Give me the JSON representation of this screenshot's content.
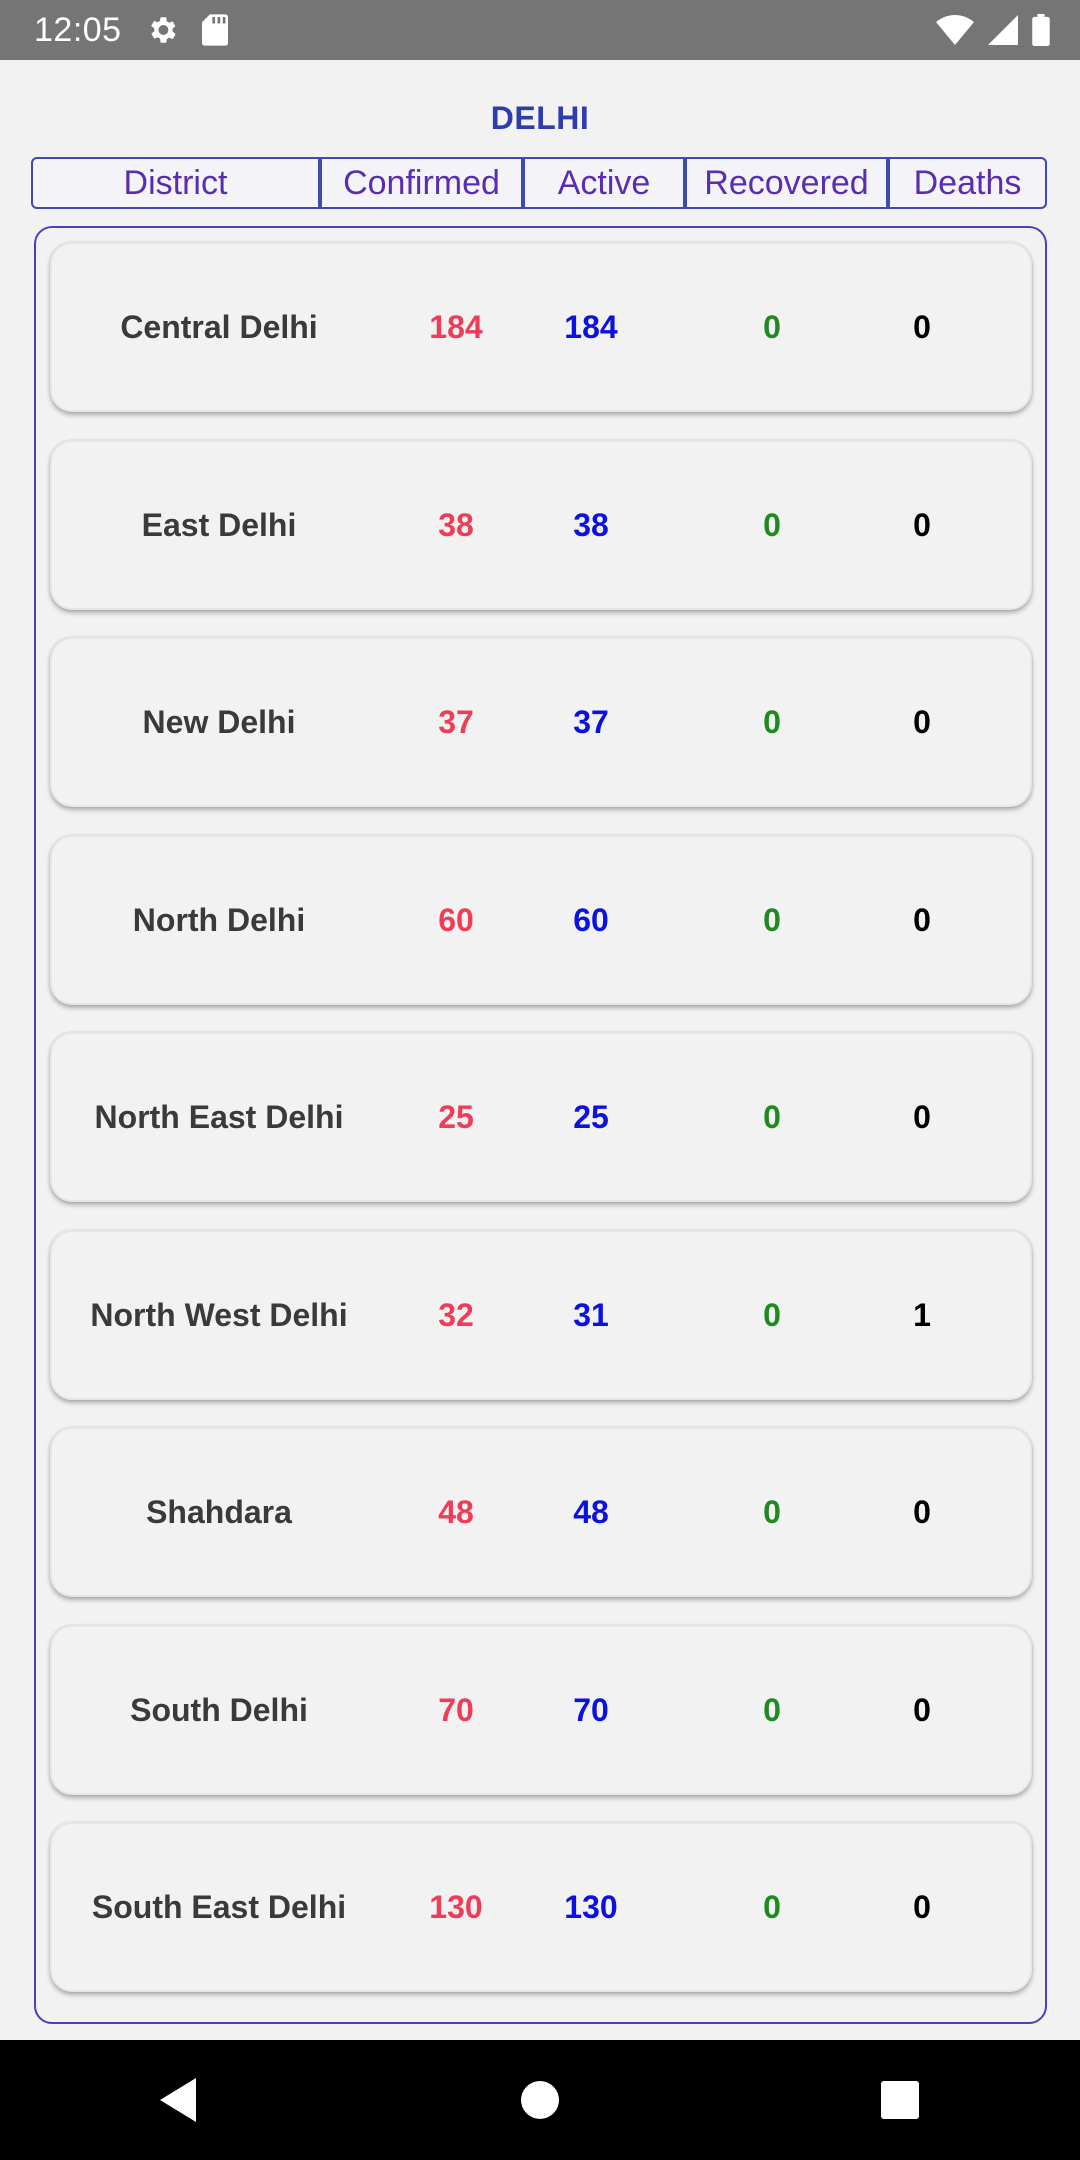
{
  "status_bar": {
    "time": "12:05",
    "icons": [
      "gear-icon",
      "sd-card-icon",
      "wifi-icon",
      "signal-icon",
      "battery-icon"
    ]
  },
  "title": "DELHI",
  "table_header": {
    "district": "District",
    "confirmed": "Confirmed",
    "active": "Active",
    "recovered": "Recovered",
    "deaths": "Deaths"
  },
  "districts": [
    {
      "name": "Central Delhi",
      "confirmed": "184",
      "active": "184",
      "recovered": "0",
      "deaths": "0"
    },
    {
      "name": "East Delhi",
      "confirmed": "38",
      "active": "38",
      "recovered": "0",
      "deaths": "0"
    },
    {
      "name": "New Delhi",
      "confirmed": "37",
      "active": "37",
      "recovered": "0",
      "deaths": "0"
    },
    {
      "name": "North Delhi",
      "confirmed": "60",
      "active": "60",
      "recovered": "0",
      "deaths": "0"
    },
    {
      "name": "North East Delhi",
      "confirmed": "25",
      "active": "25",
      "recovered": "0",
      "deaths": "0"
    },
    {
      "name": "North West Delhi",
      "confirmed": "32",
      "active": "31",
      "recovered": "0",
      "deaths": "1"
    },
    {
      "name": "Shahdara",
      "confirmed": "48",
      "active": "48",
      "recovered": "0",
      "deaths": "0"
    },
    {
      "name": "South Delhi",
      "confirmed": "70",
      "active": "70",
      "recovered": "0",
      "deaths": "0"
    },
    {
      "name": "South East Delhi",
      "confirmed": "130",
      "active": "130",
      "recovered": "0",
      "deaths": "0"
    }
  ],
  "colors": {
    "title": "#2d3dad",
    "header_text": "#5a2db0",
    "confirmed": "#f03d57",
    "active": "#0b12e0",
    "recovered": "#1f8a1f",
    "deaths": "#000000"
  },
  "nav_bar": {
    "icons": [
      "back-icon",
      "home-icon",
      "recents-icon"
    ]
  }
}
